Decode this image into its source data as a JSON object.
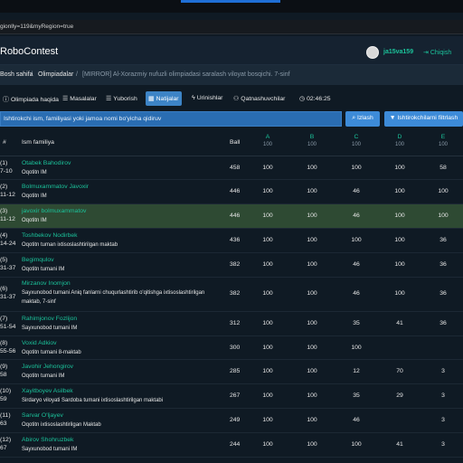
{
  "url": "gionlly=119&myRegion=true",
  "navbar": {
    "brand": "RoboContest",
    "username": "ja15va159",
    "logout": "Chiqish"
  },
  "breadcrumb": {
    "home": "Bosh sahifa",
    "separator": "/",
    "olympiads": "Olimpiadalar",
    "current": "[MIRROR] Al-Xorazmiy nufuzli olimpiadasi saralash viloyat bosqichi. 7-sinf"
  },
  "tabs": [
    {
      "label": "Olimpiada haqida",
      "icon": "info-icon"
    },
    {
      "label": "Masalalar",
      "icon": "list-icon"
    },
    {
      "label": "Yuborish",
      "icon": "list-icon"
    },
    {
      "label": "Natijalar",
      "icon": "table-icon",
      "active": true
    },
    {
      "label": "Urinishlar",
      "icon": "bolt-icon"
    },
    {
      "label": "Qatnashuvchilar",
      "icon": "users-icon"
    },
    {
      "label": "02:46:25",
      "icon": "clock-icon"
    }
  ],
  "search": {
    "placeholder": "Ishtirokchi ism, familiyasi yoki jamoa nomi bo'yicha qidiruv",
    "button": "Izlash",
    "filter_button": "Ishtirokchilarni filtrlash"
  },
  "table": {
    "headers": {
      "rank": "#",
      "name": "Ism familiya",
      "score": "Ball"
    },
    "tasks": [
      {
        "letter": "A",
        "max": "100"
      },
      {
        "letter": "B",
        "max": "100"
      },
      {
        "letter": "C",
        "max": "100"
      },
      {
        "letter": "D",
        "max": "100"
      },
      {
        "letter": "E",
        "max": "100"
      }
    ],
    "rows": [
      {
        "rank": "(1)",
        "range": "7-10",
        "name": "Otabek Bahodirov",
        "school": "Oqotitn IM",
        "score": "458",
        "tasks": [
          "100",
          "100",
          "100",
          "100",
          "58"
        ]
      },
      {
        "rank": "(2)",
        "range": "11-12",
        "name": "Bolmuxammatov Javoxir",
        "school": "Oqotitn IM",
        "score": "446",
        "tasks": [
          "100",
          "100",
          "46",
          "100",
          "100"
        ]
      },
      {
        "rank": "(3)",
        "range": "11-12",
        "name": "javoxir bolmuxammatov",
        "school": "Oqotitn IM",
        "score": "446",
        "tasks": [
          "100",
          "100",
          "46",
          "100",
          "100"
        ],
        "highlight": true
      },
      {
        "rank": "(4)",
        "range": "14-24",
        "name": "Toshbekov Nodirbek",
        "school": "Oqotitn tuman ixtisoslashtirilgan maktab",
        "score": "436",
        "tasks": [
          "100",
          "100",
          "100",
          "100",
          "36"
        ]
      },
      {
        "rank": "(5)",
        "range": "31-37",
        "name": "Begimqulov",
        "school": "Oqotitn tumani IM",
        "score": "382",
        "tasks": [
          "100",
          "100",
          "46",
          "100",
          "36"
        ]
      },
      {
        "rank": "(6)",
        "range": "31-37",
        "name": "Mirzanov Inomjon",
        "school": "Sayxunobod tumani Aniq fanlarni chuqurlashtirib o'qitishga ixtisoslashtirilgan maktab, 7-sinf",
        "score": "382",
        "tasks": [
          "100",
          "100",
          "46",
          "100",
          "36"
        ]
      },
      {
        "rank": "(7)",
        "range": "51-54",
        "name": "Rahimjonov Fozlijon",
        "school": "Sayxunobod tumani IM",
        "score": "312",
        "tasks": [
          "100",
          "100",
          "35",
          "41",
          "36"
        ]
      },
      {
        "rank": "(8)",
        "range": "55-56",
        "name": "Voxid Adkiov",
        "school": "Oqotitn tumani 8-maktab",
        "score": "300",
        "tasks": [
          "100",
          "100",
          "100",
          "",
          ""
        ]
      },
      {
        "rank": "(9)",
        "range": "58",
        "name": "Javohir Jehongirov",
        "school": "Oqotitn tumani IM",
        "score": "285",
        "tasks": [
          "100",
          "100",
          "12",
          "70",
          "3"
        ]
      },
      {
        "rank": "(10)",
        "range": "59",
        "name": "Xayitboyev Asilbek",
        "school": "Sirdaryo viloyati Sardoba tumani ixtisoslashtirilgan maktabi",
        "score": "267",
        "tasks": [
          "100",
          "100",
          "35",
          "29",
          "3"
        ]
      },
      {
        "rank": "(11)",
        "range": "63",
        "name": "Sarvar O'ljayev",
        "school": "Oqotitn ixtisoslashtirilgan Maktab",
        "score": "249",
        "tasks": [
          "100",
          "100",
          "46",
          "",
          "3"
        ]
      },
      {
        "rank": "(12)",
        "range": "67",
        "name": "Abirov Shohruzbek",
        "school": "Sayxunobod tumani IM",
        "score": "244",
        "tasks": [
          "100",
          "100",
          "100",
          "41",
          "3"
        ]
      }
    ]
  }
}
